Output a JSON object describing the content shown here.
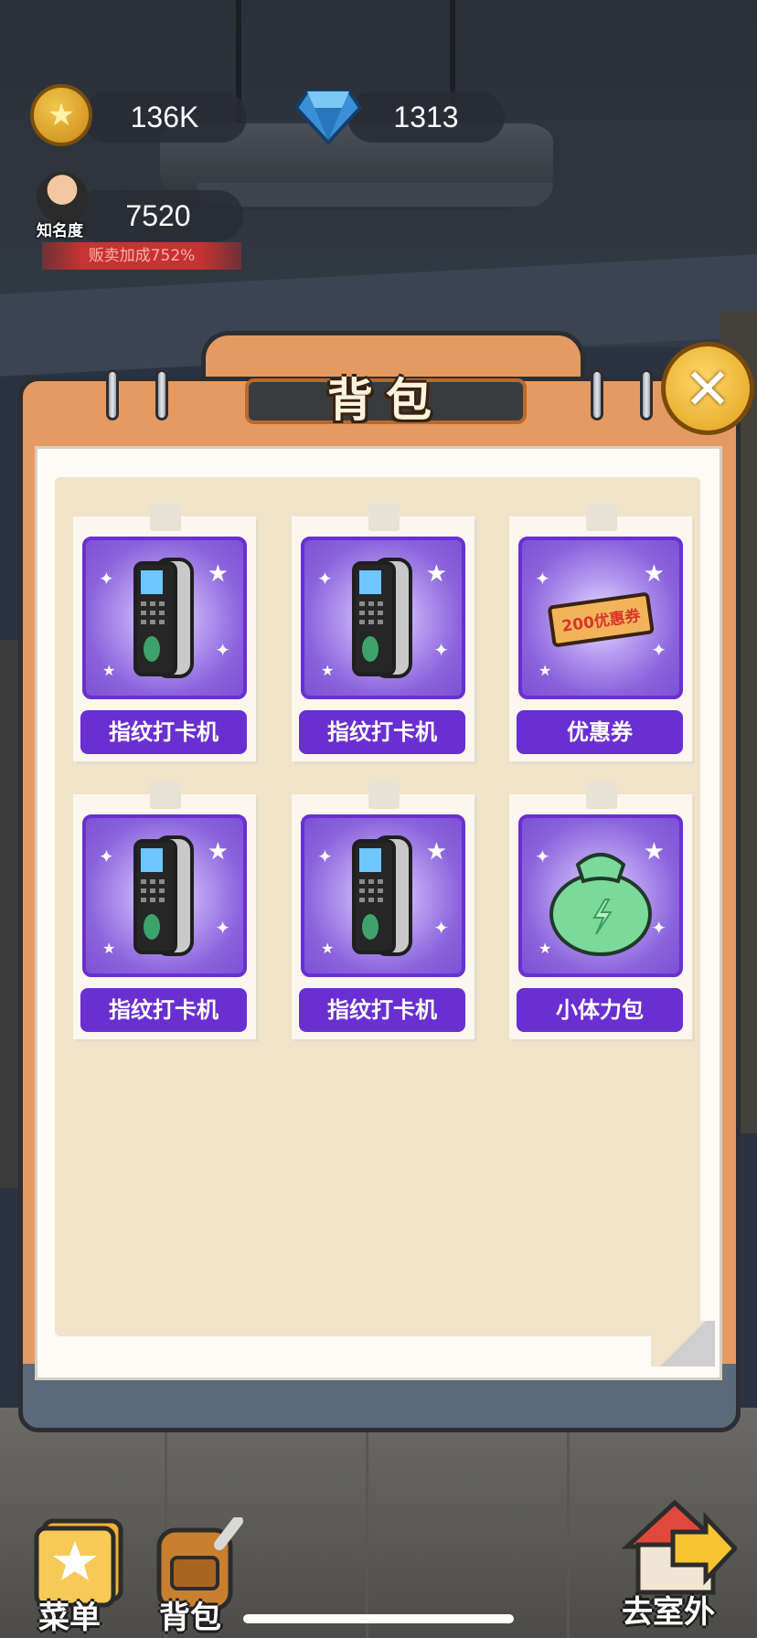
{
  "hud": {
    "coins": "136K",
    "gems": "1313",
    "fame": "7520",
    "fame_label": "知名度",
    "sales_bonus": "贩卖加成752%"
  },
  "modal": {
    "title": "背包"
  },
  "items": [
    {
      "label": "指纹打卡机",
      "icon": "fingerprint-clock-icon"
    },
    {
      "label": "指纹打卡机",
      "icon": "fingerprint-clock-icon"
    },
    {
      "label": "优惠券",
      "icon": "coupon-icon",
      "coupon_text": "200优惠券"
    },
    {
      "label": "指纹打卡机",
      "icon": "fingerprint-clock-icon"
    },
    {
      "label": "指纹打卡机",
      "icon": "fingerprint-clock-icon"
    },
    {
      "label": "小体力包",
      "icon": "energy-bag-icon"
    }
  ],
  "nav": {
    "menu": "菜单",
    "bag": "背包",
    "outdoor": "去室外"
  },
  "colors": {
    "card_purple": "#6a2fd0",
    "panel_orange": "#e59a62",
    "paper_beige": "#f1e3c9"
  }
}
